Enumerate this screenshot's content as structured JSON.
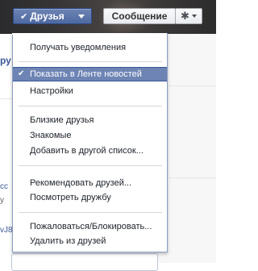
{
  "header": {
    "friends_button": {
      "check": "✔",
      "label": "Друзья"
    },
    "message_button": {
      "label": "Сообщение"
    },
    "gear_button": {
      "icon": "gear-icon",
      "glyph": "✱"
    }
  },
  "left_fragments": [
    "ру",
    "сс",
    "у",
    "vJ8"
  ],
  "dropdown": {
    "items": [
      {
        "label": "Получать уведомления",
        "active": false
      },
      {
        "label": "Показать в Ленте новостей",
        "active": true,
        "check": "✔"
      },
      {
        "label": "Настройки",
        "active": false
      },
      {
        "label": "Близкие друзья",
        "active": false
      },
      {
        "label": "Знакомые",
        "active": false
      },
      {
        "label": "Добавить в другой список...",
        "active": false
      },
      {
        "label": "Рекомендовать друзей...",
        "active": false
      },
      {
        "label": "Посмотреть дружбу",
        "active": false
      },
      {
        "label": "Пожаловаться/Блокировать...",
        "active": false
      },
      {
        "label": "Удалить из друзей",
        "active": false
      }
    ]
  },
  "colors": {
    "accent": "#6d84b4",
    "button_blue": "#4e69a2",
    "border_blue": "#3b5998"
  }
}
